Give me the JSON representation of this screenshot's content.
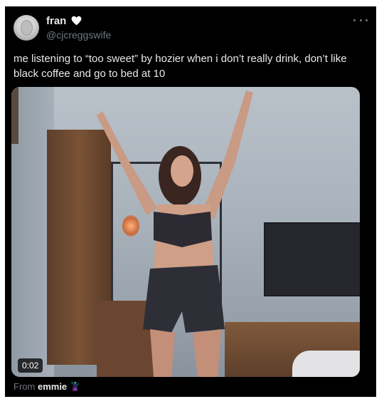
{
  "tweet": {
    "display_name": "fran",
    "name_emoji": "white-heart-icon",
    "handle": "@cjcreggswife",
    "text": "me listening to “too sweet” by hozier when i don’t really drink, don’t like black coffee and go to bed at 10",
    "more_icon": "more-horizontal-icon"
  },
  "media": {
    "type": "video",
    "duration": "0:02"
  },
  "source": {
    "prefix": "From",
    "name": "emmie",
    "name_emoji": "🦹"
  },
  "colors": {
    "card_background": "#000000",
    "primary_text": "#e7e9ea",
    "secondary_text": "#71767b"
  }
}
